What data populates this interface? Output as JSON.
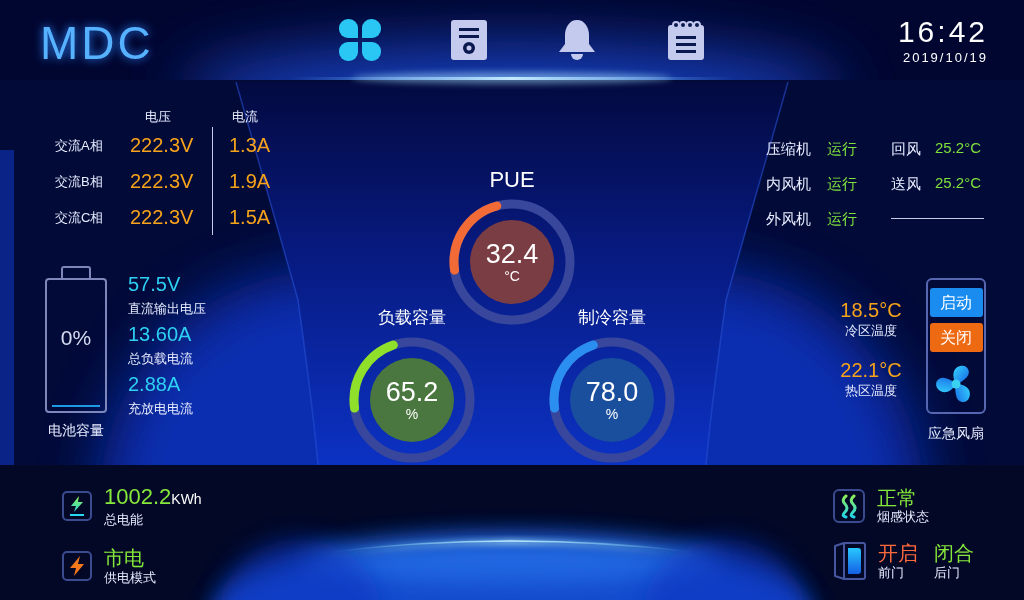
{
  "header": {
    "logo": "MDC",
    "nav": [
      {
        "selected": true
      },
      {
        "selected": false
      },
      {
        "selected": false
      },
      {
        "selected": false
      }
    ],
    "time": "16:42",
    "date": "2019/10/19"
  },
  "ac": {
    "columns": [
      "电压",
      "电流"
    ],
    "rows": [
      {
        "label": "交流A相",
        "voltage": "222.3V",
        "current": "1.3A"
      },
      {
        "label": "交流B相",
        "voltage": "222.3V",
        "current": "1.9A"
      },
      {
        "label": "交流C相",
        "voltage": "222.3V",
        "current": "1.5A"
      }
    ]
  },
  "battery": {
    "reading": "0%",
    "level": 0,
    "label": "电池容量"
  },
  "dc": [
    {
      "value": "57.5V",
      "label": "直流输出电压"
    },
    {
      "value": "13.60A",
      "label": "总负载电流"
    },
    {
      "value": "2.88A",
      "label": "充放电电流"
    }
  ],
  "gauges": [
    {
      "title": "PUE",
      "value": "32.4",
      "unit": "°C",
      "level": 0.23,
      "color": "#f26a35"
    },
    {
      "title": "负载容量",
      "value": "65.2",
      "unit": "%",
      "level": 0.22,
      "color": "#8ee02a"
    },
    {
      "title": "制冷容量",
      "value": "78.0",
      "unit": "%",
      "level": 0.22,
      "color": "#2a8ff0"
    }
  ],
  "equipment": [
    {
      "name": "压缩机",
      "status": "运行"
    },
    {
      "name": "内风机",
      "status": "运行"
    },
    {
      "name": "外风机",
      "status": "运行"
    }
  ],
  "air": [
    {
      "name": "回风",
      "value": "25.2°C"
    },
    {
      "name": "送风",
      "value": "25.2°C"
    }
  ],
  "zones": [
    {
      "value": "18.5°C",
      "label": "冷区温度"
    },
    {
      "value": "22.1°C",
      "label": "热区温度"
    }
  ],
  "fan": {
    "buttons": [
      {
        "label": "启动",
        "color": "#1a8cf0"
      },
      {
        "label": "关闭",
        "color": "#ee6a12"
      }
    ],
    "label": "应急风扇"
  },
  "energy": {
    "value": "1002.2",
    "unit": "KWh",
    "label": "总电能"
  },
  "power": {
    "value": "市电",
    "label": "供电模式"
  },
  "smoke": {
    "value": "正常",
    "label": "烟感状态"
  },
  "doors": [
    {
      "status": "开启",
      "open": true,
      "label": "前门"
    },
    {
      "status": "闭合",
      "open": false,
      "label": "后门"
    }
  ]
}
